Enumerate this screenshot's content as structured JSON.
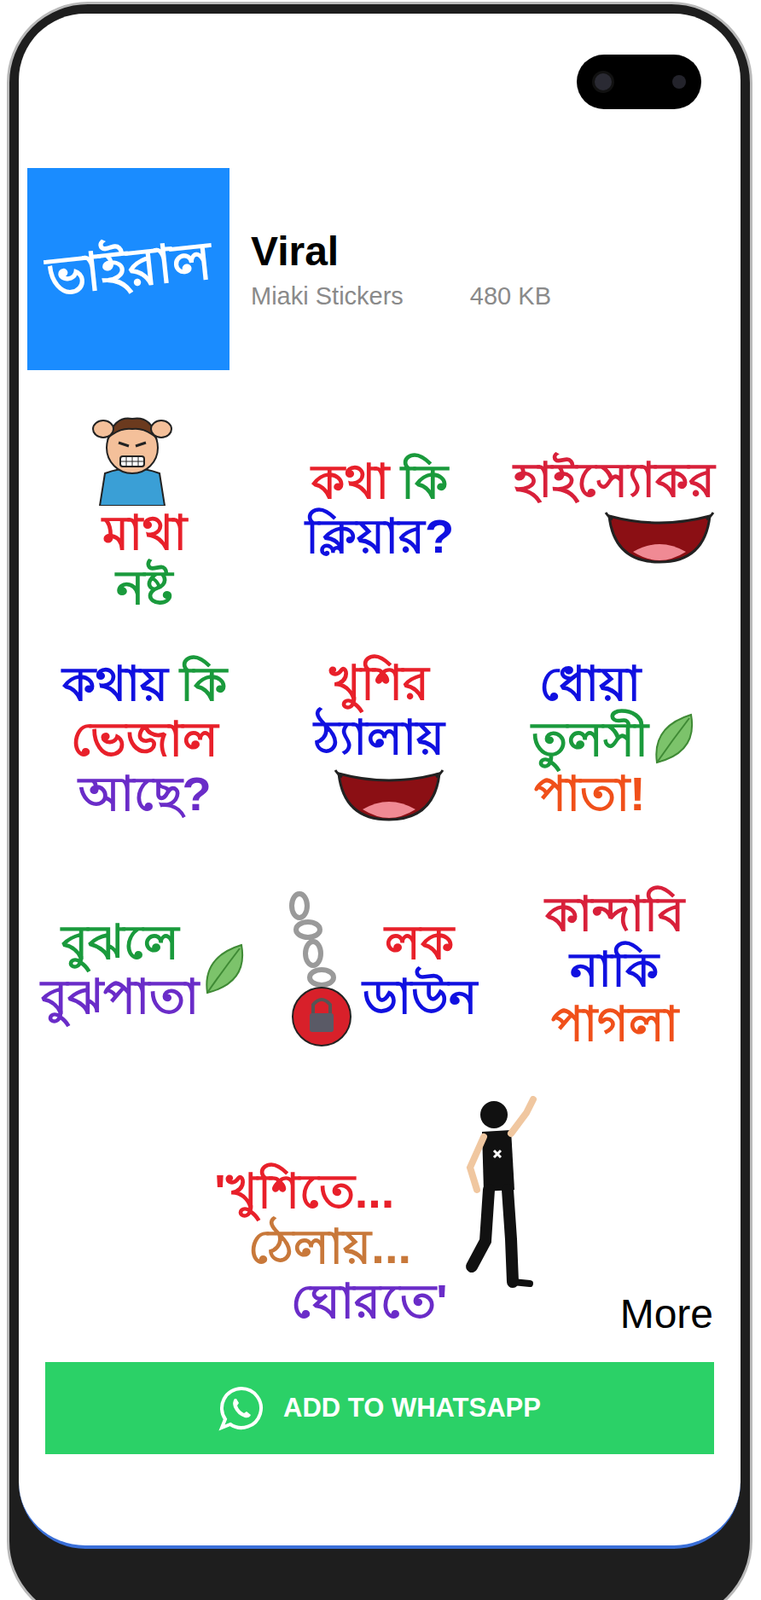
{
  "pack": {
    "logo": "ভাইরাল",
    "title": "Viral",
    "author": "Miaki Stickers",
    "size": "480 KB"
  },
  "stickers": [
    {
      "kind": "person",
      "lines": [
        [
          {
            "text": "মাথা",
            "color": "#e8202a"
          }
        ],
        [
          {
            "text": "নষ্ট",
            "color": "#1a9a3c"
          }
        ]
      ]
    },
    {
      "kind": "text",
      "lines": [
        [
          {
            "text": "কথা",
            "color": "#e8202a"
          },
          {
            "text": "কি",
            "color": "#1a9a3c"
          }
        ],
        [
          {
            "text": "ক্লিয়ার?",
            "color": "#1010e0"
          }
        ]
      ]
    },
    {
      "kind": "mouth",
      "lines": [
        [
          {
            "text": "হাইস্যোকর",
            "color": "#d8203a"
          }
        ]
      ]
    },
    {
      "kind": "text",
      "lines": [
        [
          {
            "text": "কথায়",
            "color": "#1010e0"
          },
          {
            "text": "কি",
            "color": "#1a9a3c"
          }
        ],
        [
          {
            "text": "ভেজাল",
            "color": "#e8202a"
          }
        ],
        [
          {
            "text": "আছে?",
            "color": "#6a2cc8"
          }
        ]
      ]
    },
    {
      "kind": "mouth",
      "lines": [
        [
          {
            "text": "খুশির",
            "color": "#e8202a"
          }
        ],
        [
          {
            "text": "ঠ্যালায়",
            "color": "#1010e0"
          }
        ]
      ]
    },
    {
      "kind": "leaf",
      "lines": [
        [
          {
            "text": "ধোয়া",
            "color": "#1010e0"
          }
        ],
        [
          {
            "text": "তুলসী",
            "color": "#1a9a3c"
          }
        ],
        [
          {
            "text": "পাতা!",
            "color": "#f0501a"
          }
        ]
      ]
    },
    {
      "kind": "leaf",
      "lines": [
        [
          {
            "text": "বুঝলে",
            "color": "#1a9a3c"
          }
        ],
        [
          {
            "text": "বুঝপাতা",
            "color": "#6a2cc8"
          }
        ]
      ]
    },
    {
      "kind": "lock",
      "lines": [
        [
          {
            "text": "লক",
            "color": "#e8202a"
          }
        ],
        [
          {
            "text": "ডাউন",
            "color": "#1010e0"
          }
        ]
      ]
    },
    {
      "kind": "text",
      "lines": [
        [
          {
            "text": "কান্দাবি",
            "color": "#d8203a"
          }
        ],
        [
          {
            "text": "নাকি",
            "color": "#1010e0"
          }
        ],
        [
          {
            "text": "পাগলা",
            "color": "#f0501a"
          }
        ]
      ]
    },
    {
      "kind": "dancer",
      "lines": [
        [
          {
            "text": "'খুশিতে...",
            "color": "#e8202a"
          }
        ],
        [
          {
            "text": "ঠেলায়...",
            "color": "#c8783a"
          }
        ],
        [
          {
            "text": "ঘোরতে'",
            "color": "#6a2cc8"
          }
        ]
      ]
    }
  ],
  "more": "More",
  "button": {
    "label": "ADD TO WHATSAPP"
  }
}
